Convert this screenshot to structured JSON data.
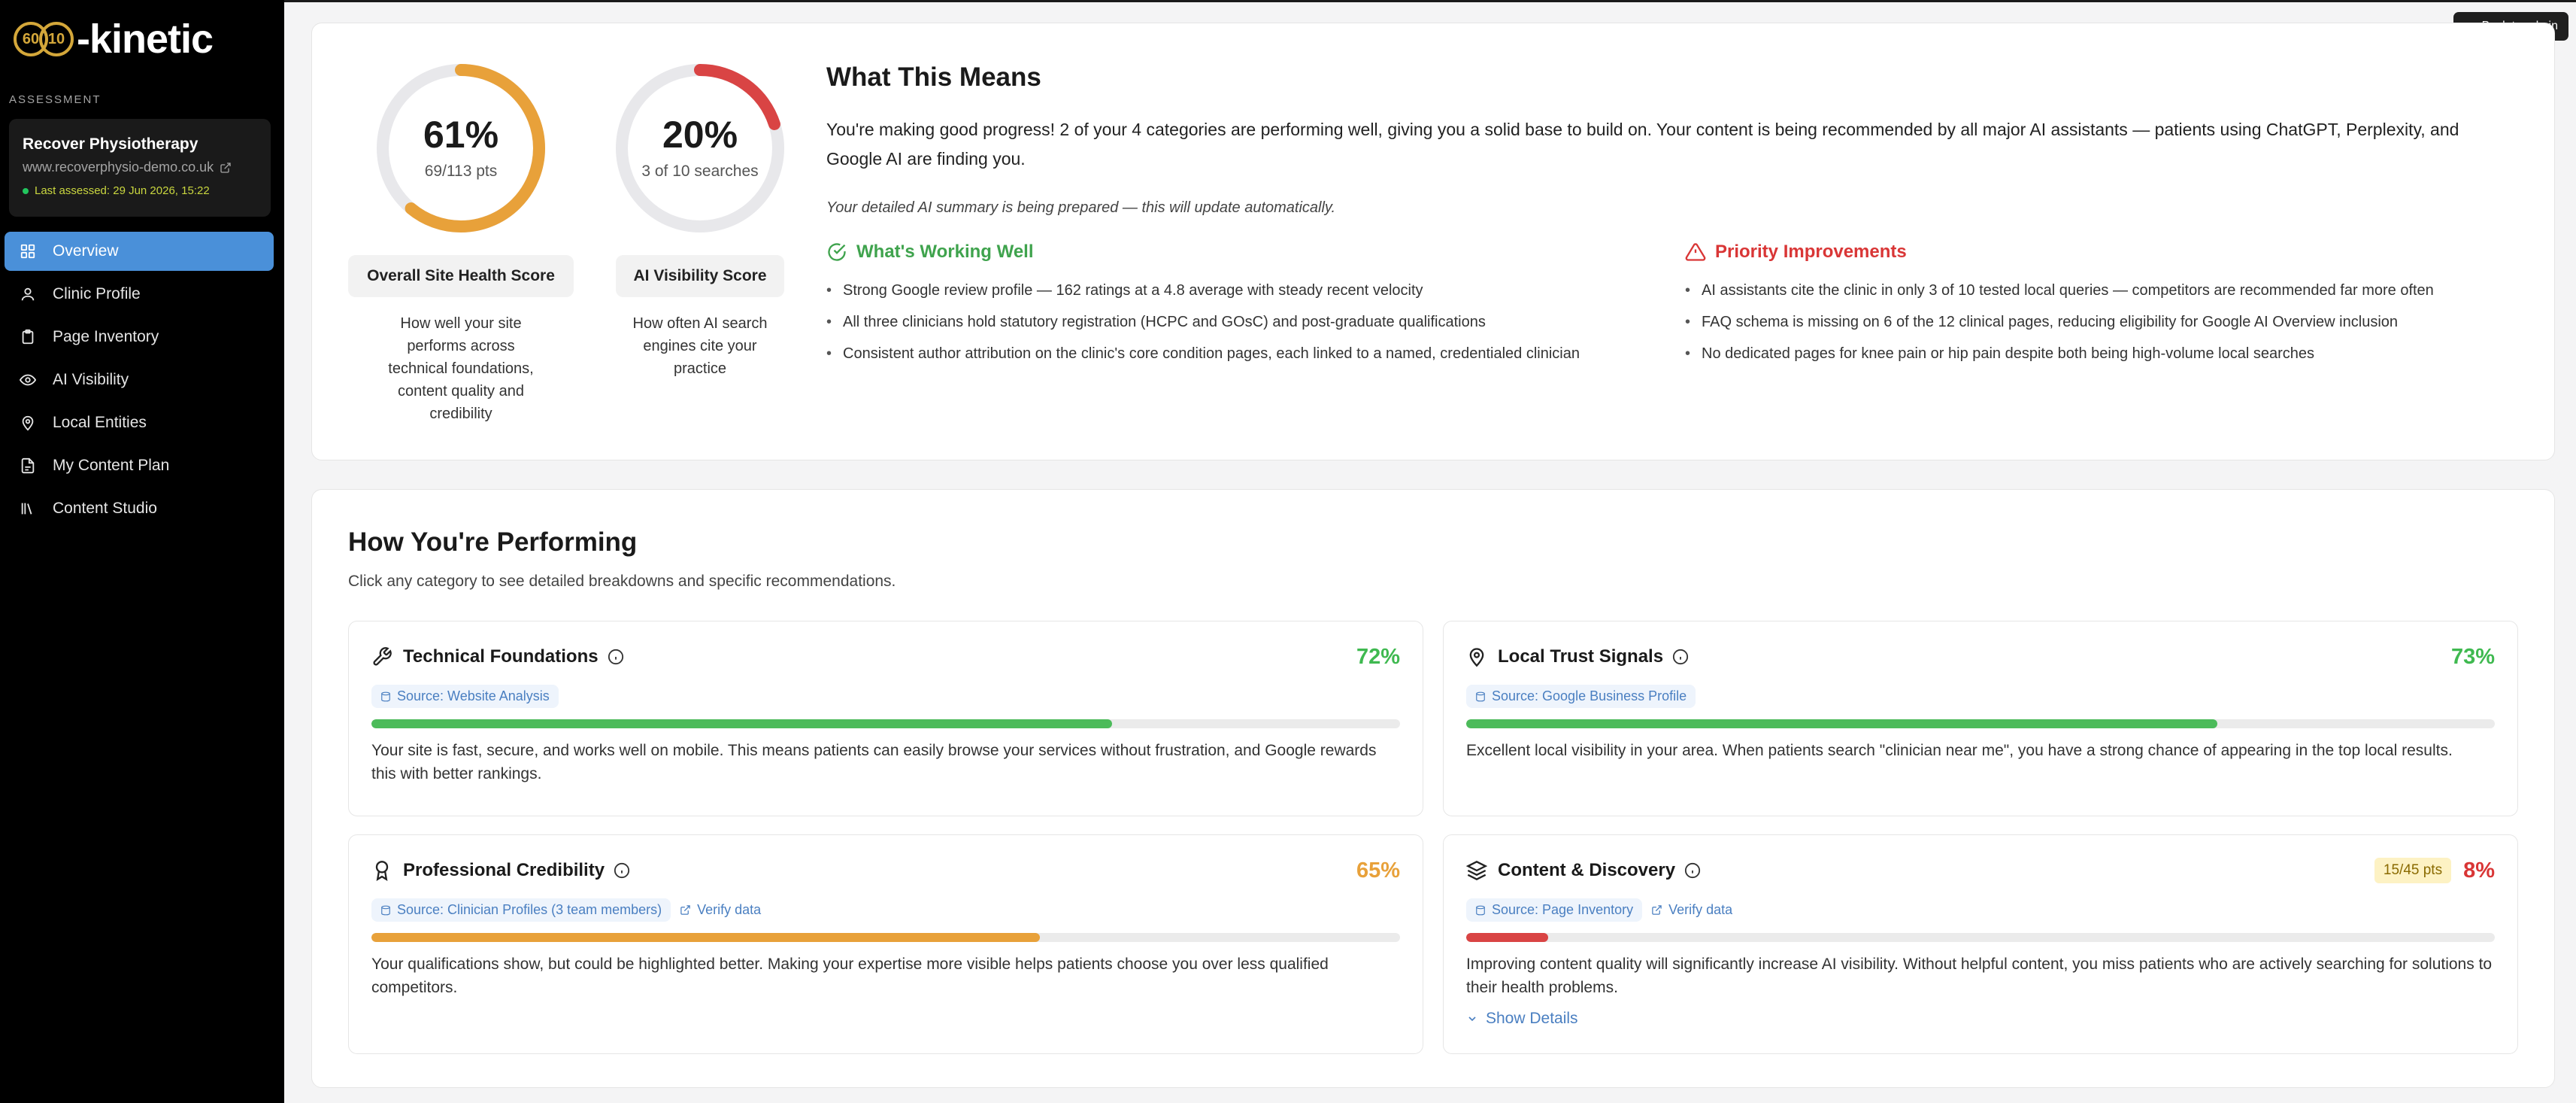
{
  "logo": {
    "badge1": "60",
    "badge2": "10",
    "text": "-kinetic"
  },
  "sidebar": {
    "section_label": "ASSESSMENT",
    "clinic": {
      "name": "Recover Physiotherapy",
      "url": "www.recoverphysio-demo.co.uk",
      "last_assessed": "Last assessed: 29 Jun 2026, 15:22"
    },
    "items": [
      {
        "label": "Overview",
        "icon": "grid-icon",
        "active": true
      },
      {
        "label": "Clinic Profile",
        "icon": "user-icon"
      },
      {
        "label": "Page Inventory",
        "icon": "clipboard-icon"
      },
      {
        "label": "AI Visibility",
        "icon": "eye-icon"
      },
      {
        "label": "Local Entities",
        "icon": "map-pin-icon"
      },
      {
        "label": "My Content Plan",
        "icon": "document-icon"
      },
      {
        "label": "Content Studio",
        "icon": "library-icon"
      }
    ]
  },
  "header": {
    "back_label": "Back to admin"
  },
  "scores": {
    "site_health": {
      "percent": 61,
      "display": "61%",
      "points": "69/113 pts",
      "title": "Overall Site Health Score",
      "description": "How well your site performs across technical foundations, content quality and credibility",
      "color": "#e8a13a"
    },
    "ai_visibility": {
      "percent": 20,
      "display": "20%",
      "points": "3 of 10 searches",
      "title": "AI Visibility Score",
      "description": "How often AI search engines cite your practice",
      "color": "#d94444"
    }
  },
  "meaning": {
    "title": "What This Means",
    "text": "You're making good progress! 2 of your 4 categories are performing well, giving you a solid base to build on. Your content is being recommended by all major AI assistants — patients using ChatGPT, Perplexity, and Google AI are finding you.",
    "note": "Your detailed AI summary is being prepared — this will update automatically.",
    "working_title": "What's Working Well",
    "working": [
      "Strong Google review profile — 162 ratings at a 4.8 average with steady recent velocity",
      "All three clinicians hold statutory registration (HCPC and GOsC) and post-graduate qualifications",
      "Consistent author attribution on the clinic's core condition pages, each linked to a named, credentialed clinician"
    ],
    "priority_title": "Priority Improvements",
    "priority": [
      "AI assistants cite the clinic in only 3 of 10 tested local queries — competitors are recommended far more often",
      "FAQ schema is missing on 6 of the 12 clinical pages, reducing eligibility for Google AI Overview inclusion",
      "No dedicated pages for knee pain or hip pain despite both being high-volume local searches"
    ]
  },
  "performance": {
    "title": "How You're Performing",
    "subtitle": "Click any category to see detailed breakdowns and specific recommendations.",
    "categories": [
      {
        "name": "Technical Foundations",
        "icon": "wrench-icon",
        "percent": 72,
        "display": "72%",
        "source": "Source: Website Analysis",
        "description": "Your site is fast, secure, and works well on mobile. This means patients can easily browse your services without frustration, and Google rewards this with better rankings.",
        "color": "#4cbb5a"
      },
      {
        "name": "Local Trust Signals",
        "icon": "map-pin-icon",
        "percent": 73,
        "display": "73%",
        "source": "Source: Google Business Profile",
        "description": "Excellent local visibility in your area. When patients search \"clinician near me\", you have a strong chance of appearing in the top local results.",
        "color": "#4cbb5a"
      },
      {
        "name": "Professional Credibility",
        "icon": "award-icon",
        "percent": 65,
        "display": "65%",
        "source": "Source: Clinician Profiles (3 team members)",
        "verify": "Verify data",
        "description": "Your qualifications show, but could be highlighted better. Making your expertise more visible helps patients choose you over less qualified competitors.",
        "color": "#e8a13a"
      },
      {
        "name": "Content & Discovery",
        "icon": "layers-icon",
        "percent": 8,
        "display": "8%",
        "points": "15/45 pts",
        "source": "Source: Page Inventory",
        "verify": "Verify data",
        "description": "Improving content quality will significantly increase AI visibility. Without helpful content, you miss patients who are actively searching for solutions to their health problems.",
        "show_details": "Show Details",
        "color": "#d94444"
      }
    ]
  }
}
